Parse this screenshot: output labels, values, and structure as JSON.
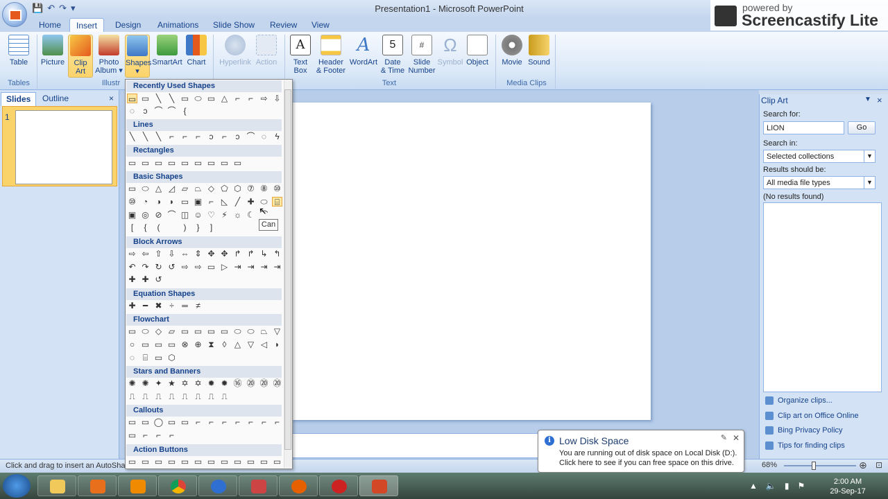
{
  "app": {
    "title": "Presentation1 - Microsoft PowerPoint"
  },
  "tabs": [
    "Home",
    "Insert",
    "Design",
    "Animations",
    "Slide Show",
    "Review",
    "View"
  ],
  "ribbon": {
    "tables": {
      "table": "Table",
      "group": "Tables"
    },
    "illustrations": {
      "picture": "Picture",
      "clip_art_1": "Clip",
      "clip_art_2": "Art",
      "photo_album_1": "Photo",
      "photo_album_2": "Album ▾",
      "shapes_1": "Shapes",
      "shapes_2": "▾",
      "smartart": "SmartArt",
      "chart": "Chart",
      "group": "Illustr"
    },
    "links": {
      "hyperlink": "Hyperlink",
      "action": "Action"
    },
    "text": {
      "textbox_1": "Text",
      "textbox_2": "Box",
      "header_1": "Header",
      "header_2": "& Footer",
      "wordart": "WordArt",
      "datetime_1": "Date",
      "datetime_2": "& Time",
      "slidenum_1": "Slide",
      "slidenum_2": "Number",
      "symbol": "Symbol",
      "object": "Object",
      "group": "Text"
    },
    "media": {
      "movie": "Movie",
      "sound": "Sound",
      "group": "Media Clips"
    }
  },
  "slides_pane": {
    "tab_slides": "Slides",
    "tab_outline": "Outline",
    "close": "×",
    "slide_num": "1"
  },
  "shapes_panel": {
    "sections": [
      "Recently Used Shapes",
      "Lines",
      "Rectangles",
      "Basic Shapes",
      "Block Arrows",
      "Equation Shapes",
      "Flowchart",
      "Stars and Banners",
      "Callouts",
      "Action Buttons"
    ],
    "tooltip": "Can"
  },
  "clip_art": {
    "title": "Clip Art",
    "search_for_label": "Search for:",
    "search_value": "LION",
    "go": "Go",
    "search_in_label": "Search in:",
    "search_in_value": "Selected collections",
    "results_label": "Results should be:",
    "results_value": "All media file types",
    "no_results": "(No results found)",
    "links": [
      "Organize clips...",
      "Clip art on Office Online",
      "Bing Privacy Policy",
      "Tips for finding clips"
    ]
  },
  "status": {
    "text": "Click and drag to insert an AutoSha",
    "zoom": "68%"
  },
  "balloon": {
    "title": "Low Disk Space",
    "message": "You are running out of disk space on Local Disk (D:). Click here to see if you can free space on this drive."
  },
  "taskbar": {
    "time": "2:00 AM",
    "date": "29-Sep-17"
  },
  "watermark": {
    "top": "powered by",
    "main": "Screencastify Lite"
  }
}
